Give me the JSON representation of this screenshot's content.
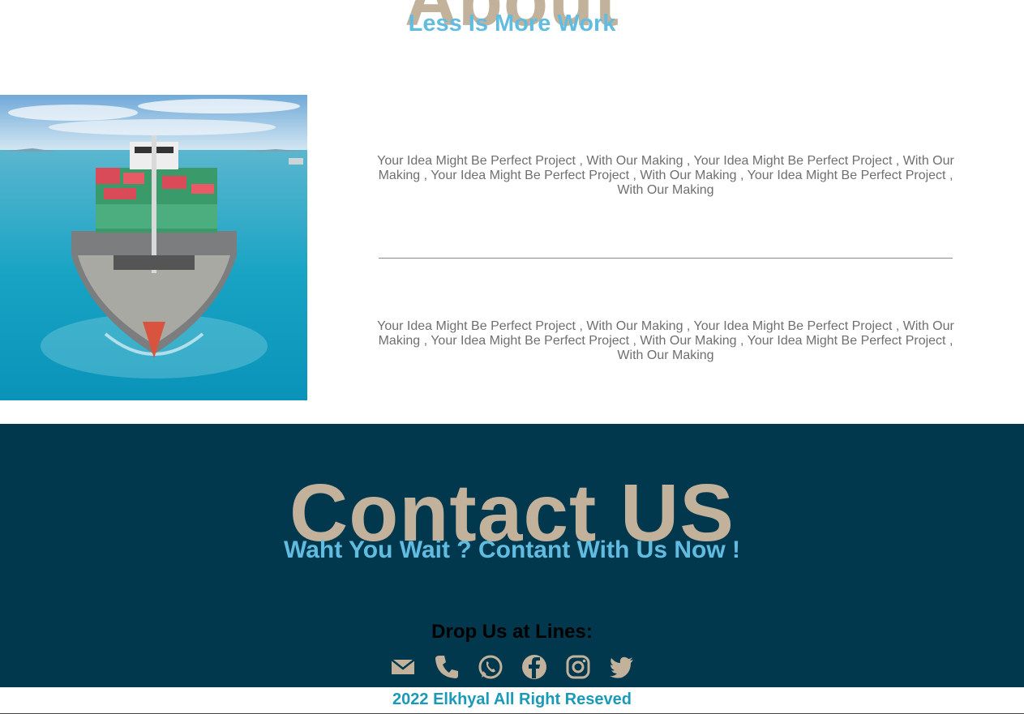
{
  "about": {
    "title": "About",
    "subtitle": "Less Is More Work",
    "paragraph_1": "Your Idea Might Be Perfect Project , With Our Making , Your Idea Might Be Perfect Project , With Our Making , Your Idea Might Be Perfect Project , With Our Making , Your Idea Might Be Perfect Project , With Our Making",
    "paragraph_2": "Your Idea Might Be Perfect Project , With Our Making , Your Idea Might Be Perfect Project , With Our Making , Your Idea Might Be Perfect Project , With Our Making , Your Idea Might Be Perfect Project , With Our Making"
  },
  "contact": {
    "title": "Contact US",
    "subtitle": "Waht You Wait ? Contant With Us Now !",
    "drop_lines": "Drop Us at Lines:",
    "icons": [
      "envelope-icon",
      "phone-icon",
      "whatsapp-icon",
      "facebook-icon",
      "instagram-icon",
      "twitter-icon"
    ]
  },
  "footer": {
    "copyright": "2022 Elkhyal All Right Reseved"
  },
  "colors": {
    "heading_tan": "#c2b29c",
    "subtitle_blue": "#62bce0",
    "contact_bg": "#02384d",
    "footer_text": "#1a9ab8",
    "paragraph_gray": "#6f6f6f"
  }
}
